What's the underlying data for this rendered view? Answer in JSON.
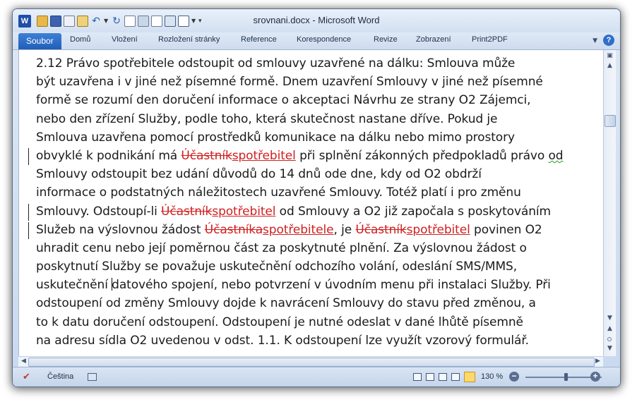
{
  "window": {
    "title": "srovnani.docx - Microsoft Word",
    "app_icon_letter": "W"
  },
  "ribbon": {
    "tabs": [
      "Soubor",
      "Domů",
      "Vložení",
      "Rozložení stránky",
      "Reference",
      "Korespondence",
      "Revize",
      "Zobrazení",
      "Print2PDF"
    ],
    "help_label": "?"
  },
  "document": {
    "lines": [
      [
        {
          "t": "2.12 Právo spotřebitele odstoupit od smlouvy uzavřené na dálku: Smlouva může"
        }
      ],
      [
        {
          "t": "být uzavřena i v jiné než písemné formě. Dnem uzavření Smlouvy v jiné než písemné"
        }
      ],
      [
        {
          "t": "formě se rozumí den doručení informace o akceptaci Návrhu ze strany O2 Zájemci,"
        }
      ],
      [
        {
          "t": "nebo den zřízení Služby, podle toho, která skutečnost nastane dříve. Pokud je"
        }
      ],
      [
        {
          "t": "Smlouva uzavřena pomocí prostředků komunikace na dálku nebo mimo prostory"
        }
      ],
      [
        {
          "t": "obvyklé k podnikání má "
        },
        {
          "t": "Účastník",
          "s": "del"
        },
        {
          "t": "spotřebitel",
          "s": "ins"
        },
        {
          "t": " při splnění zákonných předpokladů právo "
        },
        {
          "t": "od",
          "s": "squiggle"
        }
      ],
      [
        {
          "t": "Smlouvy odstoupit bez udání důvodů do 14 dnů ode dne, kdy od O2 obdrží"
        }
      ],
      [
        {
          "t": "informace o podstatných náležitostech uzavřené Smlouvy. Totéž platí i pro změnu"
        }
      ],
      [
        {
          "t": "Smlouvy. Odstoupí-li "
        },
        {
          "t": "Účastník",
          "s": "del"
        },
        {
          "t": "spotřebitel",
          "s": "ins"
        },
        {
          "t": " od Smlouvy a O2 již započala s poskytováním"
        }
      ],
      [
        {
          "t": "Služeb na výslovnou žádost "
        },
        {
          "t": "Účastníka",
          "s": "del"
        },
        {
          "t": "spotřebitele",
          "s": "ins"
        },
        {
          "t": ", je "
        },
        {
          "t": "Účastník",
          "s": "del"
        },
        {
          "t": "spotřebitel",
          "s": "ins"
        },
        {
          "t": " povinen O2"
        }
      ],
      [
        {
          "t": "uhradit cenu nebo její poměrnou část za poskytnuté plnění. Za výslovnou žádost o"
        }
      ],
      [
        {
          "t": "poskytnutí Služby se považuje uskutečnění odchozího volání, odeslání SMS/MMS,"
        }
      ],
      [
        {
          "t": "uskutečnění "
        },
        {
          "t": "",
          "s": "cursor"
        },
        {
          "t": "datového spojení, nebo potvrzení v úvodním menu při instalaci Služby. Při"
        }
      ],
      [
        {
          "t": "odstoupení od změny Smlouvy dojde k navrácení Smlouvy do stavu před změnou, a"
        }
      ],
      [
        {
          "t": "to k datu doručení odstoupení. Odstoupení je nutné odeslat v dané lhůtě písemně"
        }
      ],
      [
        {
          "t": "na adresu sídla O2 uvedenou v odst. 1.1. K odstoupení lze využít vzorový formulář."
        }
      ]
    ],
    "track_change_line_indices": [
      5,
      8,
      9
    ]
  },
  "status_bar": {
    "language": "Čeština",
    "zoom_label": "130 %",
    "zoom_percent": 130,
    "active_view": "draft"
  },
  "colors": {
    "revision": "#d02020",
    "accent": "#2f6fc9"
  }
}
